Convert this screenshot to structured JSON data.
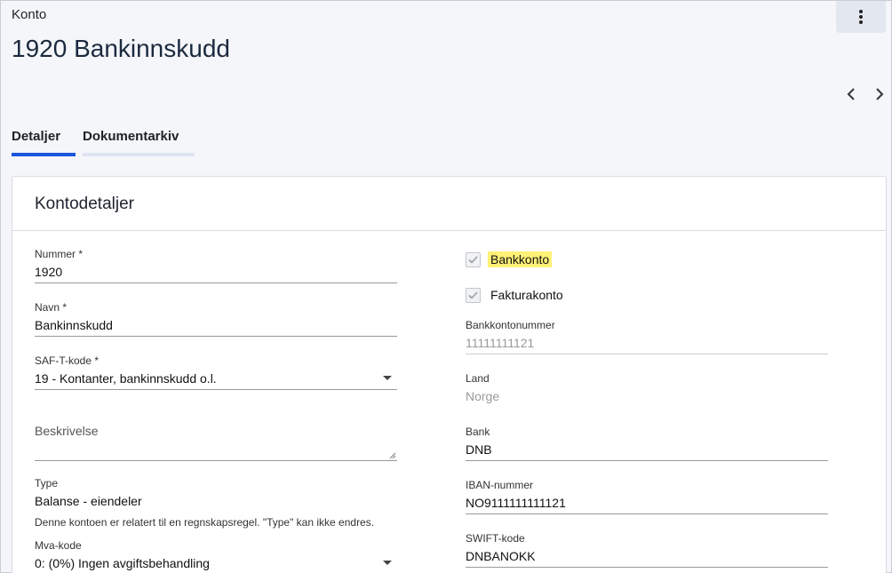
{
  "header": {
    "breadcrumb": "Konto",
    "title": "1920 Bankinnskudd",
    "menu_icon": "more-vertical-icon",
    "prev_icon": "chevron-left-icon",
    "next_icon": "chevron-right-icon"
  },
  "tabs": [
    {
      "label": "Detaljer",
      "active": true
    },
    {
      "label": "Dokumentarkiv",
      "active": false
    }
  ],
  "card": {
    "title": "Kontodetaljer",
    "left": {
      "nummer": {
        "label": "Nummer *",
        "value": "1920"
      },
      "navn": {
        "label": "Navn *",
        "value": "Bankinnskudd"
      },
      "saft": {
        "label": "SAF-T-kode *",
        "value": "19 - Kontanter, bankinnskudd o.l."
      },
      "beskrivelse": {
        "label": "Beskrivelse",
        "value": ""
      },
      "type": {
        "label": "Type",
        "value": "Balanse - eiendeler",
        "hint": "Denne kontoen er relatert til en regnskapsregel. \"Type\" kan ikke endres."
      },
      "mva": {
        "label": "Mva-kode",
        "value": "0: (0%) Ingen avgiftsbehandling"
      }
    },
    "right": {
      "bankkonto": {
        "label": "Bankkonto",
        "checked": true
      },
      "fakturakonto": {
        "label": "Fakturakonto",
        "checked": true
      },
      "bankkontonummer": {
        "label": "Bankkontonummer",
        "value": "11111111121"
      },
      "land": {
        "label": "Land",
        "value": "Norge"
      },
      "bank": {
        "label": "Bank",
        "value": "DNB"
      },
      "iban": {
        "label": "IBAN-nummer",
        "value": "NO9111111111121"
      },
      "swift": {
        "label": "SWIFT-kode",
        "value": "DNBANOKK"
      }
    }
  },
  "colors": {
    "accent": "#1a56db",
    "highlight": "#fff176"
  }
}
